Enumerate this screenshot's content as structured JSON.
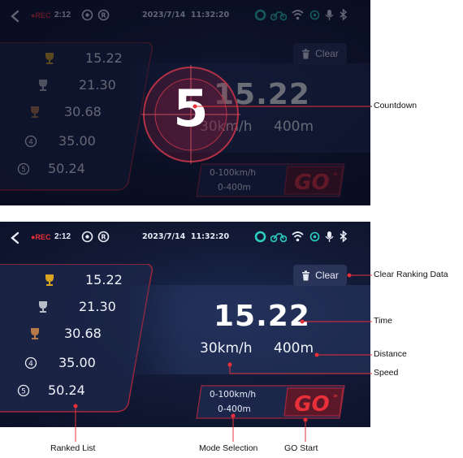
{
  "status": {
    "rec_label": "●REC",
    "rec_time": "2:12",
    "date": "2023/7/14",
    "time": "11:32:20"
  },
  "clear_label": "Clear",
  "ranking": [
    "15.22",
    "21.30",
    "30.68",
    "35.00",
    "50.24"
  ],
  "rank_badges": [
    "4",
    "5"
  ],
  "metrics": {
    "time": "15.22",
    "speed": "30km/h",
    "distance": "400m"
  },
  "mode": {
    "line1": "0-100km/h",
    "line2": "0-400m"
  },
  "go_label": "GO",
  "countdown": "5",
  "callouts": {
    "countdown": "Countdown",
    "clear": "Clear Ranking Data",
    "time": "Time",
    "distance": "Distance",
    "speed": "Speed",
    "ranked_list": "Ranked List",
    "mode_selection": "Mode Selection",
    "go_start": "GO Start"
  },
  "colors": {
    "accent_red": "#e8303a",
    "gold": "#d9a521",
    "silver": "#b8bcc8",
    "bronze": "#b7794a",
    "bg": "#121a36"
  },
  "icons": [
    "back-chevron-icon",
    "recording-dot-icon",
    "settings-badge-icon",
    "record-badge-icon",
    "circle-status-icon",
    "motorcycle-icon",
    "wifi-icon",
    "gps-icon",
    "microphone-icon",
    "bluetooth-icon",
    "trash-icon",
    "trophy-icon"
  ]
}
